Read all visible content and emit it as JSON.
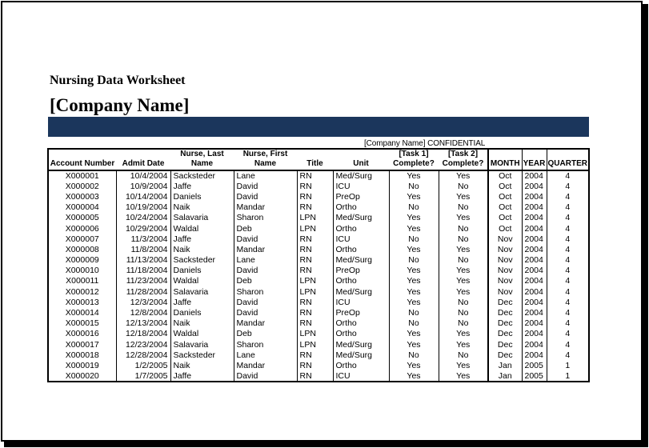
{
  "document": {
    "title": "Nursing Data Worksheet",
    "company_name": "[Company Name]",
    "confidential_label": "[Company Name] CONFIDENTIAL",
    "banner_color": "#1b365c"
  },
  "table": {
    "headers": [
      "Account Number",
      "Admit Date",
      "Nurse, Last Name",
      "Nurse, First Name",
      "Title",
      "Unit",
      "[Task 1] Complete?",
      "[Task 2] Complete?",
      "MONTH",
      "YEAR",
      "QUARTER"
    ],
    "rows": [
      [
        "X000001",
        "10/4/2004",
        "Sacksteder",
        "Lane",
        "RN",
        "Med/Surg",
        "Yes",
        "Yes",
        "Oct",
        "2004",
        "4"
      ],
      [
        "X000002",
        "10/9/2004",
        "Jaffe",
        "David",
        "RN",
        "ICU",
        "No",
        "No",
        "Oct",
        "2004",
        "4"
      ],
      [
        "X000003",
        "10/14/2004",
        "Daniels",
        "David",
        "RN",
        "PreOp",
        "Yes",
        "Yes",
        "Oct",
        "2004",
        "4"
      ],
      [
        "X000004",
        "10/19/2004",
        "Naik",
        "Mandar",
        "RN",
        "Ortho",
        "No",
        "No",
        "Oct",
        "2004",
        "4"
      ],
      [
        "X000005",
        "10/24/2004",
        "Salavaria",
        "Sharon",
        "LPN",
        "Med/Surg",
        "Yes",
        "Yes",
        "Oct",
        "2004",
        "4"
      ],
      [
        "X000006",
        "10/29/2004",
        "Waldal",
        "Deb",
        "LPN",
        "Ortho",
        "Yes",
        "No",
        "Oct",
        "2004",
        "4"
      ],
      [
        "X000007",
        "11/3/2004",
        "Jaffe",
        "David",
        "RN",
        "ICU",
        "No",
        "No",
        "Nov",
        "2004",
        "4"
      ],
      [
        "X000008",
        "11/8/2004",
        "Naik",
        "Mandar",
        "RN",
        "Ortho",
        "Yes",
        "Yes",
        "Nov",
        "2004",
        "4"
      ],
      [
        "X000009",
        "11/13/2004",
        "Sacksteder",
        "Lane",
        "RN",
        "Med/Surg",
        "No",
        "No",
        "Nov",
        "2004",
        "4"
      ],
      [
        "X000010",
        "11/18/2004",
        "Daniels",
        "David",
        "RN",
        "PreOp",
        "Yes",
        "Yes",
        "Nov",
        "2004",
        "4"
      ],
      [
        "X000011",
        "11/23/2004",
        "Waldal",
        "Deb",
        "LPN",
        "Ortho",
        "Yes",
        "Yes",
        "Nov",
        "2004",
        "4"
      ],
      [
        "X000012",
        "11/28/2004",
        "Salavaria",
        "Sharon",
        "LPN",
        "Med/Surg",
        "Yes",
        "Yes",
        "Nov",
        "2004",
        "4"
      ],
      [
        "X000013",
        "12/3/2004",
        "Jaffe",
        "David",
        "RN",
        "ICU",
        "Yes",
        "No",
        "Dec",
        "2004",
        "4"
      ],
      [
        "X000014",
        "12/8/2004",
        "Daniels",
        "David",
        "RN",
        "PreOp",
        "No",
        "No",
        "Dec",
        "2004",
        "4"
      ],
      [
        "X000015",
        "12/13/2004",
        "Naik",
        "Mandar",
        "RN",
        "Ortho",
        "No",
        "No",
        "Dec",
        "2004",
        "4"
      ],
      [
        "X000016",
        "12/18/2004",
        "Waldal",
        "Deb",
        "LPN",
        "Ortho",
        "Yes",
        "Yes",
        "Dec",
        "2004",
        "4"
      ],
      [
        "X000017",
        "12/23/2004",
        "Salavaria",
        "Sharon",
        "LPN",
        "Med/Surg",
        "Yes",
        "Yes",
        "Dec",
        "2004",
        "4"
      ],
      [
        "X000018",
        "12/28/2004",
        "Sacksteder",
        "Lane",
        "RN",
        "Med/Surg",
        "No",
        "No",
        "Dec",
        "2004",
        "4"
      ],
      [
        "X000019",
        "1/2/2005",
        "Naik",
        "Mandar",
        "RN",
        "Ortho",
        "Yes",
        "Yes",
        "Jan",
        "2005",
        "1"
      ],
      [
        "X000020",
        "1/7/2005",
        "Jaffe",
        "David",
        "RN",
        "ICU",
        "Yes",
        "Yes",
        "Jan",
        "2005",
        "1"
      ]
    ]
  }
}
